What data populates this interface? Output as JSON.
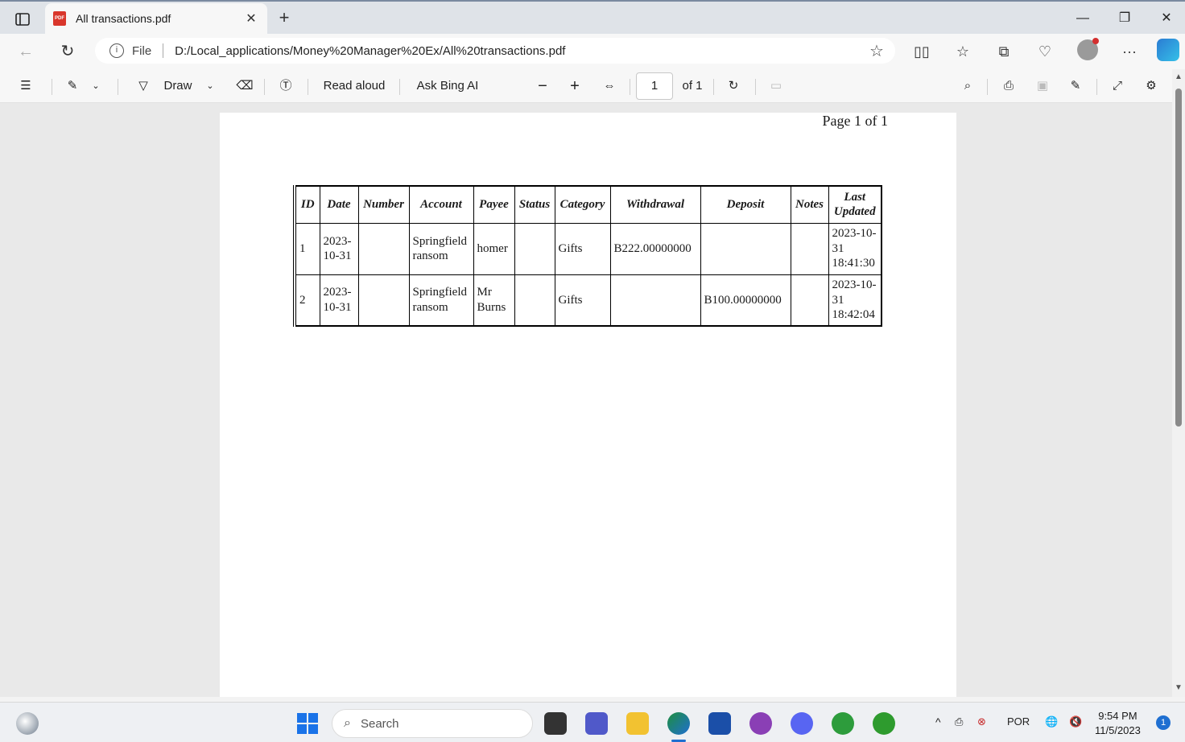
{
  "browser": {
    "tab": {
      "title": "All transactions.pdf",
      "close": "✕"
    },
    "new_tab": "+",
    "window": {
      "minimize": "—",
      "restore": "❐",
      "close": "✕"
    },
    "address": {
      "scheme_label": "File",
      "url": "D:/Local_applications/Money%20Manager%20Ex/All%20transactions.pdf"
    }
  },
  "pdf_toolbar": {
    "draw_label": "Draw",
    "read_aloud_label": "Read aloud",
    "ask_label": "Ask Bing AI",
    "page_current": "1",
    "page_total": "of 1"
  },
  "document": {
    "page_label": "Page 1 of 1",
    "table": {
      "headers": [
        "ID",
        "Date",
        "Number",
        "Account",
        "Payee",
        "Status",
        "Category",
        "Withdrawal",
        "Deposit",
        "Notes",
        "Last Updated"
      ],
      "rows": [
        [
          "1",
          "2023-10-31",
          "",
          "Springfield ransom",
          "homer",
          "",
          "Gifts",
          "B222.00000000",
          "",
          "",
          "2023-10-31 18:41:30"
        ],
        [
          "2",
          "2023-10-31",
          "",
          "Springfield ransom",
          "Mr Burns",
          "",
          "Gifts",
          "",
          "B100.00000000",
          "",
          "2023-10-31 18:42:04"
        ]
      ]
    }
  },
  "taskbar": {
    "search_placeholder": "Search",
    "tray_language": "POR",
    "time": "9:54 PM",
    "date": "11/5/2023",
    "notifications": "1"
  }
}
